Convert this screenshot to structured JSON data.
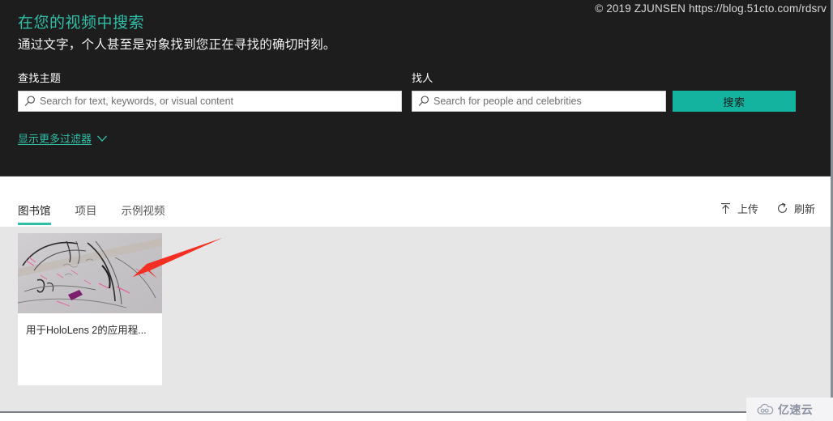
{
  "watermark_top": "© 2019 ZJUNSEN https://blog.51cto.com/rdsrv",
  "hero": {
    "title": "在您的视频中搜索",
    "subtitle": "通过文字，个人甚至是对象找到您正在寻找的确切时刻。",
    "title_color": "#2fbfa8",
    "background_color": "#1d1d1d"
  },
  "search": {
    "topic_label": "查找主题",
    "topic_placeholder": "Search for text, keywords, or visual content",
    "topic_value": "",
    "people_label": "找人",
    "people_placeholder": "Search for people and celebrities",
    "people_value": "",
    "submit_label": "搜索",
    "submit_color": "#13b3a0",
    "more_filters_label": "显示更多过滤器"
  },
  "tabs": [
    {
      "label": "图书馆",
      "active": true
    },
    {
      "label": "项目",
      "active": false
    },
    {
      "label": "示例视频",
      "active": false
    }
  ],
  "tab_actions": [
    {
      "label": "上传",
      "icon": "upload-icon"
    },
    {
      "label": "刷新",
      "icon": "refresh-icon"
    }
  ],
  "library": {
    "items": [
      {
        "title": "用于HoloLens 2的应用程..."
      }
    ]
  },
  "annotation": {
    "type": "arrow",
    "color": "#f22f22"
  },
  "watermark_badge": {
    "text": "亿速云",
    "icon": "cloud-icon"
  }
}
